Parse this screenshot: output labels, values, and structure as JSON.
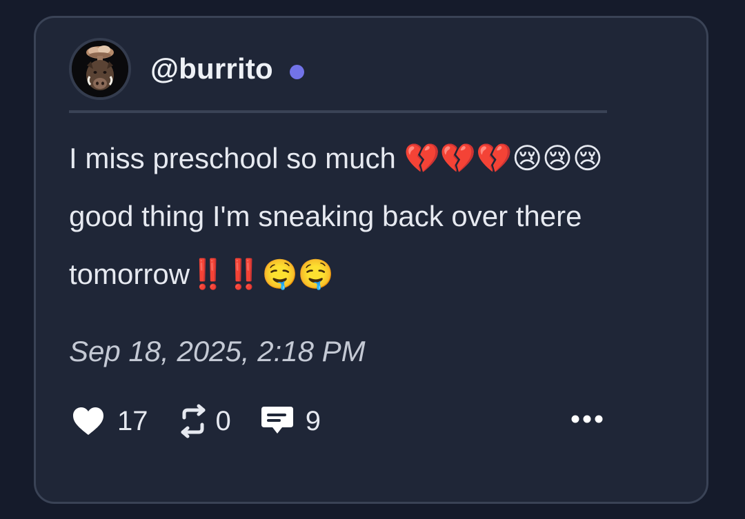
{
  "post": {
    "username": "@burrito",
    "online": true,
    "text": "I miss preschool so much 💔💔💔😢😢😢 good thing I'm sneaking back over there tomorrow‼️‼️🤤🤤",
    "timestamp": "Sep 18, 2025, 2:18 PM",
    "likes": "17",
    "reposts": "0",
    "replies": "9"
  },
  "icons": {
    "avatar": "boar-with-mushroom-cloud-avatar",
    "like": "heart-icon",
    "repost": "repost-arrows-icon",
    "reply": "comment-bubble-icon",
    "more": "more-dots-icon"
  },
  "colors": {
    "page_background": "#151b2b",
    "card_background": "#1f2637",
    "card_border": "#3a4356",
    "online_dot": "#7273e8",
    "text": "#e6e9f0",
    "timestamp": "#c4c9d4"
  }
}
